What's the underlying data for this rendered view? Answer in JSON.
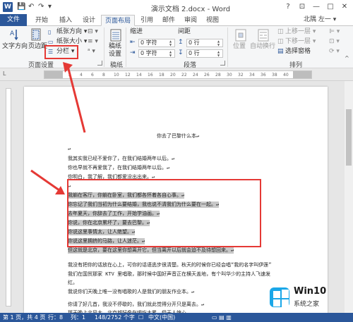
{
  "window": {
    "title": "演示文档 2.docx - Word",
    "minimize_label": "?",
    "restore_label": "⊡",
    "min_glyph": "—",
    "max_glyph": "□",
    "close_glyph": "✕"
  },
  "quick_access": {
    "save": "💾",
    "undo": "↶",
    "redo": "↷",
    "more": "▾"
  },
  "tabs": {
    "file": "文件",
    "home": "开始",
    "insert": "插入",
    "design": "设计",
    "layout": "页面布局",
    "references": "引用",
    "mailings": "邮件",
    "review": "审阅",
    "view": "视图"
  },
  "user": {
    "name": "北隅 左一 ▾"
  },
  "ribbon": {
    "text_direction": "文字方向",
    "margins": "页边距",
    "orientation": "纸张方向 ▾",
    "size": "纸张大小 ▾",
    "columns": "分栏 ▾",
    "page_setup_group": "页面设置",
    "draft_line1": "稿纸",
    "draft_line2": "设置",
    "draft_group": "稿纸",
    "indent": "缩进",
    "spacing": "间距",
    "indent_left": "0 字符",
    "indent_right": "0 字符",
    "spacing_before": "0 行",
    "spacing_after": "0 行",
    "paragraph_group": "段落",
    "position": "位置",
    "wrap": "自动换行",
    "bring_forward": "上移一层 ▾",
    "send_backward": "下移一层 ▾",
    "selection_pane": "选择窗格",
    "align": "▾",
    "arrange_group": "排列"
  },
  "ruler_ticks": [
    "2",
    "4",
    "6",
    "8",
    "10",
    "12",
    "14",
    "16",
    "18",
    "20",
    "22",
    "24",
    "26",
    "28",
    "30",
    "32",
    "34",
    "36",
    "38",
    "40"
  ],
  "document": {
    "heading": "你去了巴黎什么本↵",
    "lines": [
      "我其实我已经不爱你了，在我们结婚两年以后。↵",
      "你也早就不再爱我了，在我们结婚两年以后。↵",
      "你明白，我了解，我们都爱没出出来。↵"
    ],
    "highlighted": [
      "我躺在客厅，你躺在卧室，我们都各怀着各自心事。↵",
      "你忘记了我们当初为什么要结婚，我也说不清我们为什么要在一起。↵",
      "去年夏天，你辞去了工作，开始学油画。↵",
      "你说，你在北京累坏了，要去巴黎。↵",
      "你说这里事情太，让人绝望。↵",
      "你说这里拥挤的马路，让人迷茫。↵",
      "但这就是北京，要在这里你想离开它，但当离开以后就会迫不及待想回来。↵"
    ],
    "after": [
      "我没有把你的话放在心上，可你的话语逃步很清楚。秋天的时候你已经会唱“我的名字叫伊莲”",
      "我们在国贸那家 KTV 里唱歌，那时候中国好声音正在横天盖地，有个叫华少的主持人飞速发",
      "红。",
      "我说你们天晚上唯一没有唱歌的人是我们的朋友作业本。↵",
      "你请了好几首，我没不停歇的，我们就此觉得分开只是离去。↵",
      "那天晚上北风大，北京城好像在喝吃太累，但无人惊心。"
    ]
  },
  "status": {
    "page": "第 1 页，共 4 页",
    "row": "行：8",
    "col": "列：1",
    "words": "148/2752 个字",
    "track": "☐",
    "lang": "中文(中国)",
    "zoom_icons": "▭ ▤ ▥"
  },
  "watermark": {
    "brand": "Win10",
    "subtitle": "系统之家"
  },
  "colors": {
    "accent": "#2b579a",
    "annotation": "#e53935",
    "highlight": "#c8c8c8"
  }
}
